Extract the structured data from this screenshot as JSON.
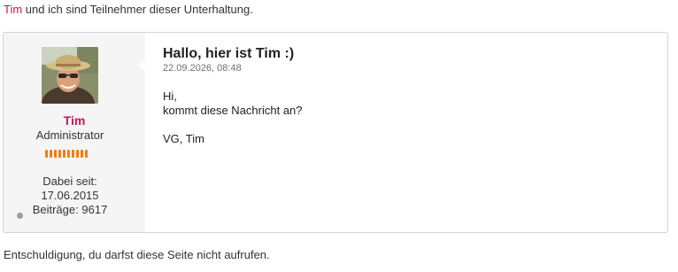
{
  "participants": {
    "user": "Tim",
    "text": " und ich sind Teilnehmer dieser Unterhaltung."
  },
  "author": {
    "name": "Tim",
    "rank": "Administrator",
    "rank_level_pips": 10,
    "member_since_label": "Dabei seit:",
    "member_since": "17.06.2015",
    "posts_label": "Beiträge:",
    "posts": "9617",
    "online_status": "offline",
    "avatar_icon": "user-avatar-photo"
  },
  "message": {
    "title": "Hallo, hier ist Tim :)",
    "date": "22.09.2026, 08:48",
    "body": {
      "line1": "Hi,",
      "line2": "kommt diese Nachricht an?",
      "line3": "VG, Tim"
    }
  },
  "error": "Entschuldigung, du darfst diese Seite nicht aufrufen.",
  "colors": {
    "username": "#c2185b",
    "rank_bar": "#f07f0a",
    "panel_bg": "#f5f5f5",
    "border": "#d4d4d4"
  }
}
